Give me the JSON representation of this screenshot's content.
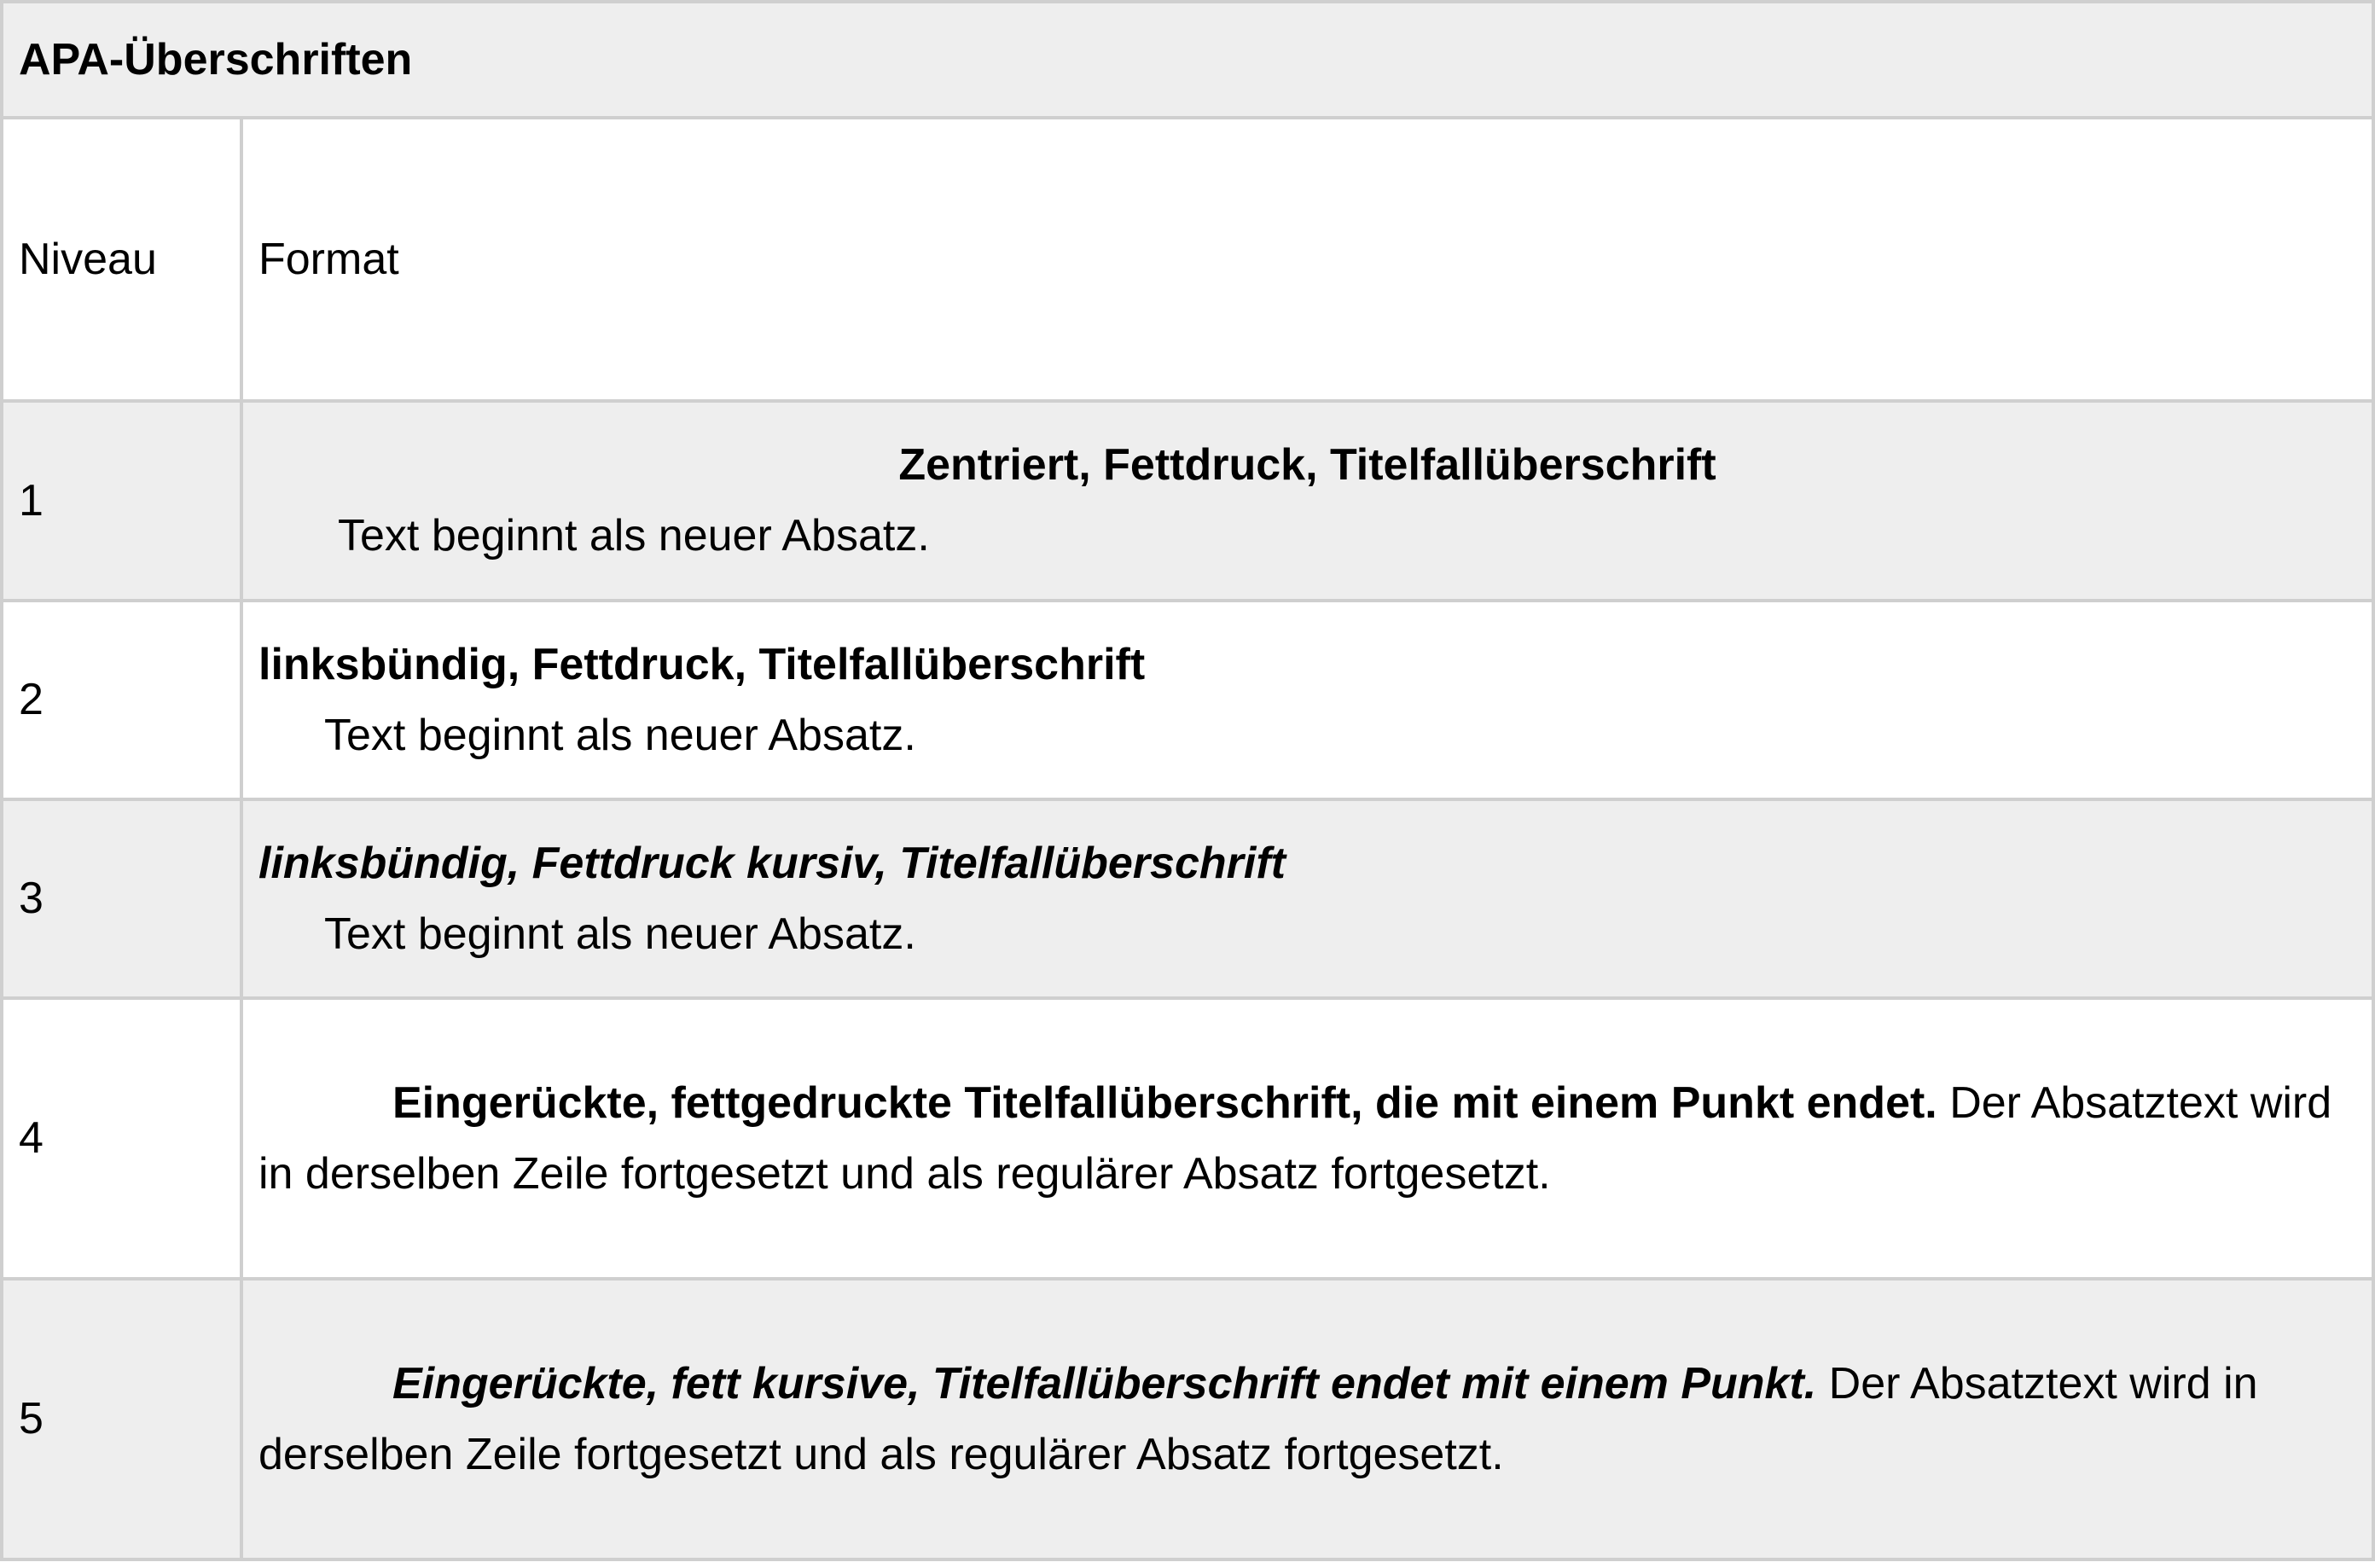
{
  "table": {
    "title": "APA-Überschriften",
    "headers": {
      "level": "Niveau",
      "format": "Format"
    },
    "rows": [
      {
        "level": "1",
        "heading": "Zentriert, Fettdruck, Titelfallüberschrift",
        "text": "Text beginnt als neuer Absatz."
      },
      {
        "level": "2",
        "heading": "linksbündig, Fettdruck, Titelfallüberschrift",
        "text": "Text beginnt als neuer Absatz."
      },
      {
        "level": "3",
        "heading": "linksbündig, Fettdruck kursiv, Titelfallüberschrift",
        "text": "Text beginnt als neuer Absatz."
      },
      {
        "level": "4",
        "heading": "Eingerückte, fettgedruckte Titelfallüberschrift, die mit einem Punkt endet.",
        "text": " Der Absatztext wird in derselben Zeile fortgesetzt und als regulärer Absatz fortgesetzt."
      },
      {
        "level": "5",
        "heading": "Eingerückte, fett kursive, Titelfallüberschrift endet mit einem Punkt.",
        "text": " Der Absatztext wird in derselben Zeile fortgesetzt und als regulärer Absatz fortgesetzt."
      }
    ]
  },
  "colors": {
    "row_shade": "#eeeeee",
    "border": "#cfcfcf"
  }
}
